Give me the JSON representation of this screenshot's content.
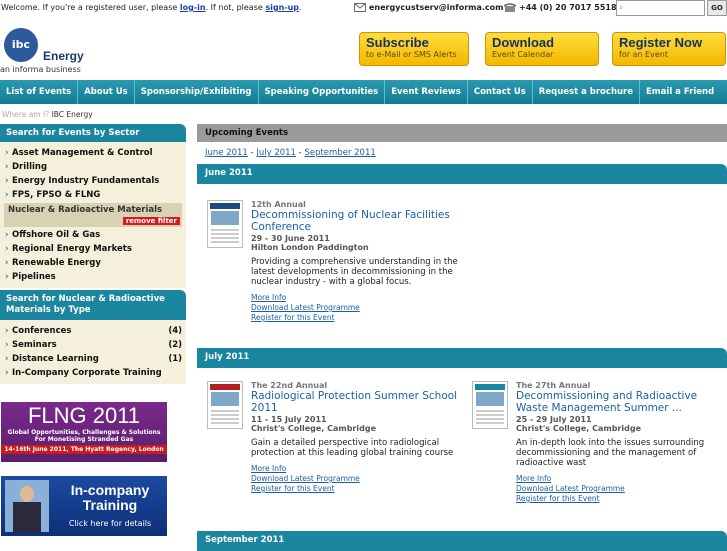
{
  "topbar": {
    "welcome_text": "Welcome. If you're a registered user, please",
    "login_link": "log-in",
    "not_text": ". If not, please",
    "signup_link": "sign-up",
    "end_text": ".",
    "email": "energycustserv@informa.com",
    "phone": "+44 (0) 20 7017 5518",
    "search_placeholder": "",
    "go_label": "GO"
  },
  "logo": {
    "mark": "ibc",
    "brand": "Energy",
    "tagline": "an informa business"
  },
  "cta": [
    {
      "title": "Subscribe",
      "sub": "to e-Mail or SMS Alerts"
    },
    {
      "title": "Download",
      "sub": "Event Calendar"
    },
    {
      "title": "Register Now",
      "sub": "for an Event"
    }
  ],
  "nav": [
    "List of Events",
    "About Us",
    "Sponsorship/Exhibiting",
    "Speaking Opportunities",
    "Event Reviews",
    "Contact Us",
    "Request a brochure",
    "Email a Friend"
  ],
  "breadcrumb": {
    "prefix": "Where am I?",
    "current": "IBC Energy"
  },
  "sector": {
    "heading": "Search for Events by Sector",
    "items_top": [
      "Asset Management & Control",
      "Drilling",
      "Energy Industry Fundamentals",
      "FPS, FPSO & FLNG"
    ],
    "selected": "Nuclear & Radioactive Materials",
    "remove_filter": "remove filter",
    "items_bottom": [
      "Offshore Oil & Gas",
      "Regional Energy Markets",
      "Renewable Energy",
      "Pipelines"
    ]
  },
  "types": {
    "heading": "Search for Nuclear & Radioactive Materials by Type",
    "items": [
      {
        "label": "Conferences",
        "count": "(4)"
      },
      {
        "label": "Seminars",
        "count": "(2)"
      },
      {
        "label": "Distance Learning",
        "count": "(1)"
      },
      {
        "label": "In-Company Corporate Training",
        "count": ""
      }
    ]
  },
  "banner_flng": {
    "title": "FLNG 2011",
    "sub1": "Global Opportunities, Challenges & Solutions",
    "sub2": "For Monetising Stranded Gas",
    "date": "14-16th June 2011, The Hyatt Regency, London"
  },
  "banner_incompany": {
    "line1": "In-company",
    "line2": "Training",
    "cta": "Click here for details"
  },
  "main": {
    "heading": "Upcoming Events",
    "month_links": [
      "June 2011",
      "July 2011",
      "September 2011"
    ],
    "sep": "-",
    "sections": [
      {
        "month": "June 2011"
      },
      {
        "month": "July 2011"
      },
      {
        "month": "September 2011"
      }
    ],
    "events": [
      {
        "annual": "12th Annual",
        "title": "Decommissioning of Nuclear Facilities Conference",
        "date": "29 - 30 June 2011",
        "venue": "Hilton London Paddington",
        "desc": "Providing a comprehensive understanding in the latest developments in decommissioning in the nuclear industry - with a global focus.",
        "more": "More Info",
        "download": "Download Latest Programme",
        "register": "Register for this Event"
      },
      {
        "annual": "The 22nd Annual",
        "title": "Radiological Protection Summer School 2011",
        "date": "11 - 15 July 2011",
        "venue": "Christ's College, Cambridge",
        "desc": "Gain a detailed perspective into radiological protection at this leading global training course",
        "more": "More Info",
        "download": "Download Latest Programme",
        "register": "Register for this Event"
      },
      {
        "annual": "The 27th Annual",
        "title": "Decommissioning and Radioactive Waste Management Summer ...",
        "date": "25 - 29 July 2011",
        "venue": "Christ's College, Cambridge",
        "desc": "An in-depth look into the issues surrounding decommissioning and the management of radioactive wast",
        "more": "More Info",
        "download": "Download Latest Programme",
        "register": "Register for this Event"
      }
    ]
  }
}
